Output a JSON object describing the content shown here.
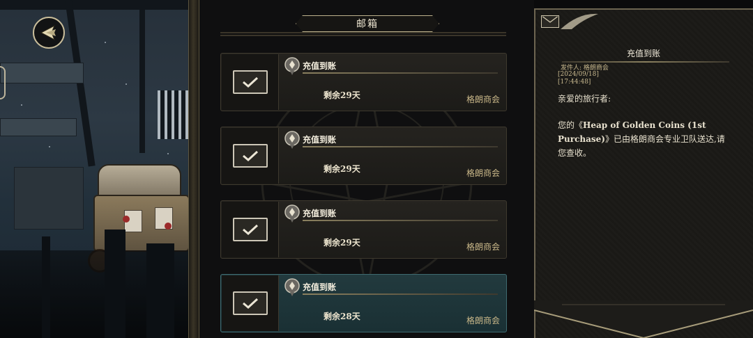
{
  "header": {
    "title": "邮箱"
  },
  "nav": {
    "back_icon": "back-arrow-icon"
  },
  "mail_list": [
    {
      "title": "充值到账",
      "remaining": "剩余29天",
      "sender": "格朗商会",
      "selected": false
    },
    {
      "title": "充值到账",
      "remaining": "剩余29天",
      "sender": "格朗商会",
      "selected": false
    },
    {
      "title": "充值到账",
      "remaining": "剩余29天",
      "sender": "格朗商会",
      "selected": false
    },
    {
      "title": "充值到账",
      "remaining": "剩余28天",
      "sender": "格朗商会",
      "selected": true
    }
  ],
  "detail": {
    "title": "充值到账",
    "sender_line": "发件人: 格朗商会",
    "date": "[2024/09/18]",
    "time": "[17:44:48]",
    "greeting": "亲爱的旅行者:",
    "body_prefix": "您的《",
    "body_item": "Heap of Golden Coins (1st Purchase)",
    "body_suffix": "》已由格朗商会专业卫队送达,请您查收。"
  },
  "colors": {
    "gold": "#bfb38e",
    "selected_teal": "#1a3034",
    "sender_gold": "#cbb98a"
  }
}
